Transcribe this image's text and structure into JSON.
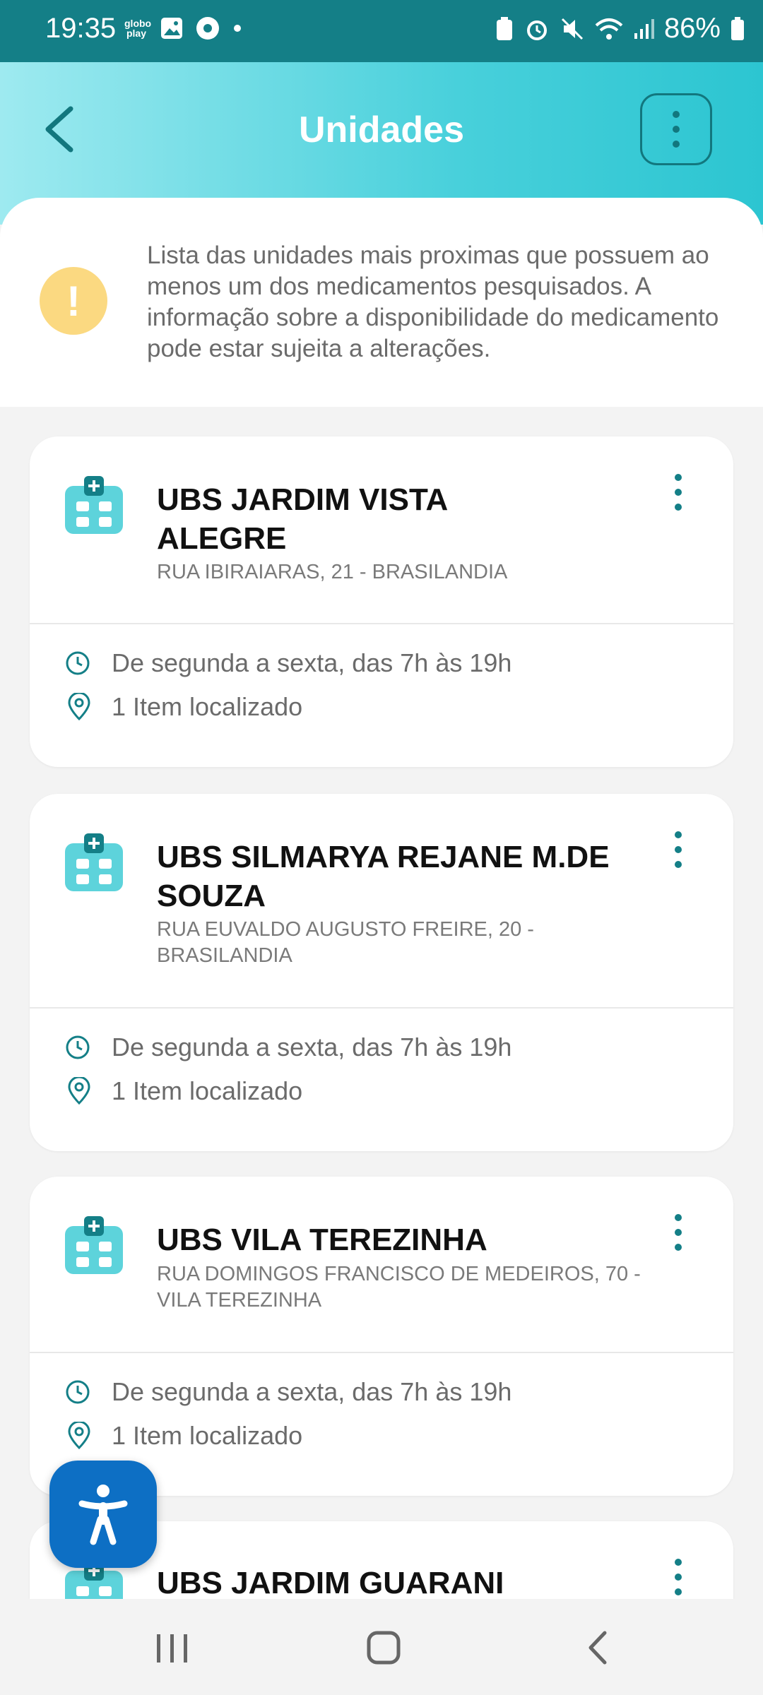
{
  "status_bar": {
    "time": "19:35",
    "app_badge": "globo play",
    "battery": "86%"
  },
  "header": {
    "title": "Unidades"
  },
  "notice": {
    "text": "Lista das unidades mais proximas que possuem ao menos um dos medicamentos pesquisados. A informação sobre a disponibilidade do medicamento pode estar sujeita a alterações."
  },
  "units": [
    {
      "name": "UBS JARDIM VISTA ALEGRE",
      "address": "RUA IBIRAIARAS, 21 - BRASILANDIA",
      "hours": "De segunda a sexta, das 7h às 19h",
      "items": "1 Item localizado"
    },
    {
      "name": "UBS SILMARYA REJANE M.DE SOUZA",
      "address": "RUA EUVALDO AUGUSTO FREIRE, 20 - BRASILANDIA",
      "hours": "De segunda a sexta, das 7h às 19h",
      "items": "1 Item localizado"
    },
    {
      "name": "UBS VILA TEREZINHA",
      "address": "RUA DOMINGOS FRANCISCO DE MEDEIROS, 70 - VILA TEREZINHA",
      "hours": "De segunda a sexta, das 7h às 19h",
      "items": "1 Item localizado"
    },
    {
      "name": "UBS JARDIM GUARANI"
    }
  ],
  "colors": {
    "accent": "#147f87",
    "header_start": "#9eeaf0",
    "header_end": "#2cc5d1",
    "icon": "#5dd3db",
    "fab": "#0d6fc4"
  }
}
